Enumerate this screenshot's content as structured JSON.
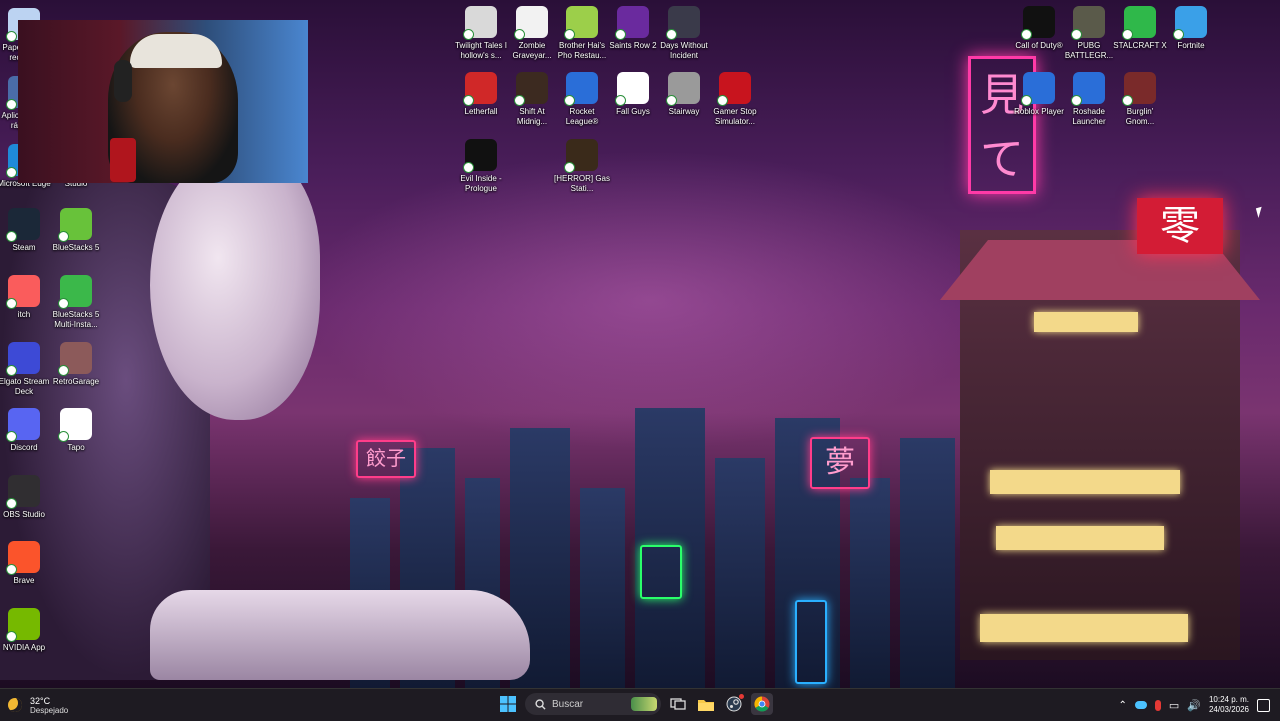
{
  "desktop": {
    "left_icons": [
      {
        "label": "Papelera de reciclaje",
        "color": "#bcd3f2"
      },
      {
        "label": "Aplicaciones rápidas",
        "color": "#4a6ca8"
      },
      {
        "label": "Microsoft Edge",
        "color": "#1f8ad8"
      },
      {
        "label": "Studio",
        "color": "#3b2e58"
      },
      {
        "label": "Steam",
        "color": "#1b2838"
      },
      {
        "label": "BlueStacks 5",
        "color": "#68c23a"
      },
      {
        "label": "itch",
        "color": "#fa5c5c"
      },
      {
        "label": "BlueStacks 5 Multi-Insta...",
        "color": "#3bb84a"
      },
      {
        "label": "Elgato Stream Deck",
        "color": "#3d4ad6"
      },
      {
        "label": "RetroGarage",
        "color": "#8c5a5a"
      },
      {
        "label": "Discord",
        "color": "#5865f2"
      },
      {
        "label": "Tapo",
        "color": "#ffffff"
      },
      {
        "label": "OBS Studio",
        "color": "#302e31"
      },
      {
        "label": "Brave",
        "color": "#fb542b"
      },
      {
        "label": "NVIDIA App",
        "color": "#76b900"
      }
    ],
    "top_icons": [
      {
        "label": "Twilight Tales I hollow's s...",
        "color": "#d9d9d9"
      },
      {
        "label": "Zombie Graveyar...",
        "color": "#f2f2f2"
      },
      {
        "label": "Brother Hai's Pho Restau...",
        "color": "#9ccf4a"
      },
      {
        "label": "Saints Row 2",
        "color": "#6a2a9e"
      },
      {
        "label": "Days Without Incident",
        "color": "#3a3a4a"
      },
      {
        "label": "Letherfall",
        "color": "#d02828"
      },
      {
        "label": "Shift At Midnig...",
        "color": "#3c2a20"
      },
      {
        "label": "Rocket League®",
        "color": "#2a6ed8"
      },
      {
        "label": "Fall Guys",
        "color": "#ffffff"
      },
      {
        "label": "Stairway",
        "color": "#9a9a9a"
      },
      {
        "label": "Gamer Stop Simulator...",
        "color": "#c8141e"
      },
      {
        "label": "Evil Inside - Prologue",
        "color": "#111111"
      },
      {
        "label": "[HERROR] Gas Stati...",
        "color": "#3a2a1a"
      }
    ],
    "right_icons": [
      {
        "label": "Call of Duty®",
        "color": "#111111"
      },
      {
        "label": "PUBG BATTLEGR...",
        "color": "#5a5a4a"
      },
      {
        "label": "STALCRAFT X",
        "color": "#2fb84a"
      },
      {
        "label": "Fortnite",
        "color": "#3aa0e8"
      },
      {
        "label": "Roblox Player",
        "color": "#2a6ed8"
      },
      {
        "label": "Roshade Launcher",
        "color": "#2a6ed8"
      },
      {
        "label": "Burglin' Gnom...",
        "color": "#7a2a2a"
      }
    ]
  },
  "wallpaper": {
    "signs": {
      "red": "零",
      "pink": "見て",
      "gyoza": "餃子",
      "dream": "夢"
    }
  },
  "taskbar": {
    "weather_temp": "32°C",
    "weather_desc": "Despejado",
    "search_placeholder": "Buscar",
    "time": "10:24 p. m.",
    "date": "24/03/2026",
    "icons": [
      "windows-start-icon",
      "search-icon",
      "widget-icon",
      "task-view-icon",
      "file-explorer-icon",
      "steam-icon",
      "chrome-icon"
    ]
  }
}
